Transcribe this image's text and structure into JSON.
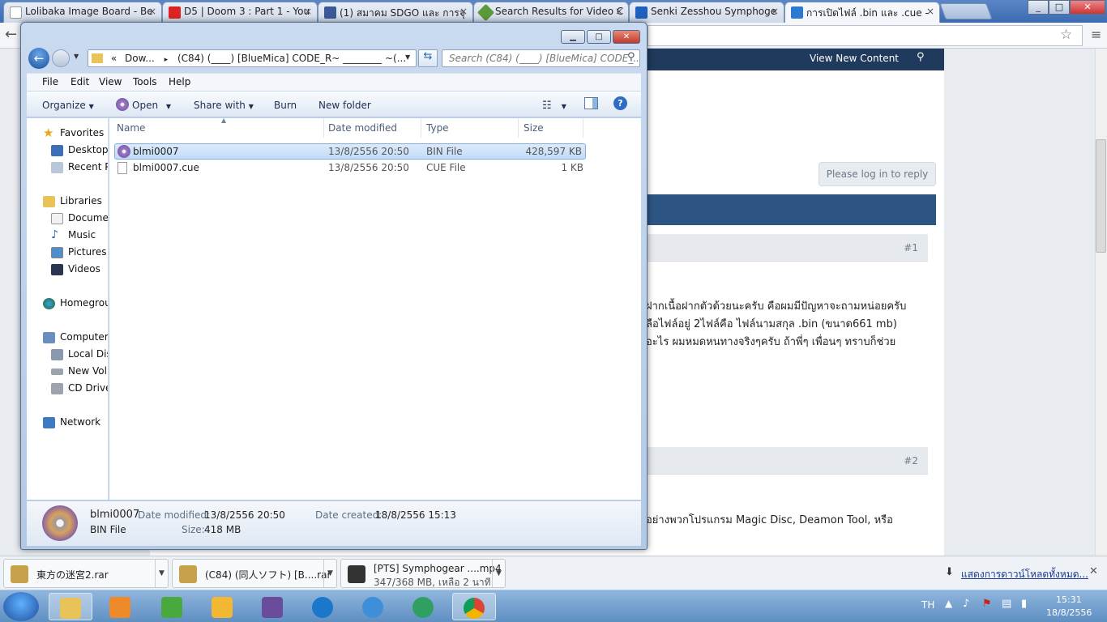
{
  "browser": {
    "tabs": [
      {
        "title": "Lolibaka Image Board - Be",
        "icon": "page-icon",
        "color": "#ffffff"
      },
      {
        "title": "D5 | Doom 3 : Part 1 - You",
        "icon": "youtube-icon",
        "color": "#d22"
      },
      {
        "title": "(1) สมาคม SDGO และ การจุ",
        "icon": "facebook-icon",
        "color": "#3b5998"
      },
      {
        "title": "Search Results for Video C",
        "icon": "tag-icon",
        "color": "#5a9a3a"
      },
      {
        "title": "Senki Zesshou Symphoge",
        "icon": "t-icon",
        "color": "#1f5fbf"
      },
      {
        "title": "การเปิดไฟล์ .bin และ .cue -",
        "icon": "forum-icon",
        "color": "#2a7ad1"
      }
    ],
    "tab_close": "×"
  },
  "web": {
    "nav_link": "View New Content",
    "login_button": "Please log in to reply",
    "post1_num": "#1",
    "post2_num": "#2",
    "post1_line1": "ฝากเนื้อฝากตัวด้วยนะครับ คือผมมีปัญหาจะถามหน่อยครับ",
    "post1_line2": "ลือไฟล์อยู่ 2ไฟล์คือ ไฟล์นามสกุล .bin (ขนาด661 mb)",
    "post1_line3": "อะไร ผมหมดหนทางจริงๆครับ ถ้าพี่ๆ เพื่อนๆ ทราบก็ช่วย",
    "post2_line1": "อย่างพวกโปรแกรม Magic Disc, Deamon Tool, หรือ"
  },
  "downloads": {
    "items": [
      {
        "name": "東方の迷宮2.rar",
        "status": ""
      },
      {
        "name": "(C84) (同人ソフト) [B....rar",
        "status": ""
      },
      {
        "name": "[PTS] Symphogear ....mp4",
        "status": "347/368 MB, เหลือ 2 นาที"
      }
    ],
    "show_all": "แสดงการดาวน์โหลดทั้งหมด..."
  },
  "taskbar": {
    "lang": "TH",
    "time": "15:31",
    "date": "18/8/2556"
  },
  "explorer": {
    "address": {
      "prefix": "«",
      "segment1": "Dow...",
      "sep": "▸",
      "segment2": "(C84) (____) [BlueMica] CODE_R~ ________ ~(..."
    },
    "search_placeholder": "Search (C84) (____) [BlueMica] CODE_...",
    "menu": [
      "File",
      "Edit",
      "View",
      "Tools",
      "Help"
    ],
    "commands": {
      "organize": "Organize",
      "open": "Open",
      "share_with": "Share with",
      "burn": "Burn",
      "new_folder": "New folder"
    },
    "nav": {
      "favorites": "Favorites",
      "desktop": "Desktop",
      "recent": "Recent Pl",
      "libraries": "Libraries",
      "documents": "Documer",
      "music": "Music",
      "pictures": "Pictures",
      "videos": "Videos",
      "homegroup": "Homegrou",
      "computer": "Computer",
      "local_disk": "Local Disl",
      "new_volume": "New Volu",
      "cd_drive": "CD Drive",
      "network": "Network"
    },
    "columns": {
      "name": "Name",
      "date": "Date modified",
      "type": "Type",
      "size": "Size"
    },
    "files": [
      {
        "name": "blmi0007",
        "date": "13/8/2556 20:50",
        "type": "BIN File",
        "size": "428,597 KB",
        "selected": true
      },
      {
        "name": "blmi0007.cue",
        "date": "13/8/2556 20:50",
        "type": "CUE File",
        "size": "1 KB",
        "selected": false
      }
    ],
    "details": {
      "name": "blmi0007",
      "type": "BIN File",
      "date_modified_label": "Date modified:",
      "date_modified": "13/8/2556 20:50",
      "size_label": "Size:",
      "size": "418 MB",
      "date_created_label": "Date created:",
      "date_created": "18/8/2556 15:13"
    }
  }
}
